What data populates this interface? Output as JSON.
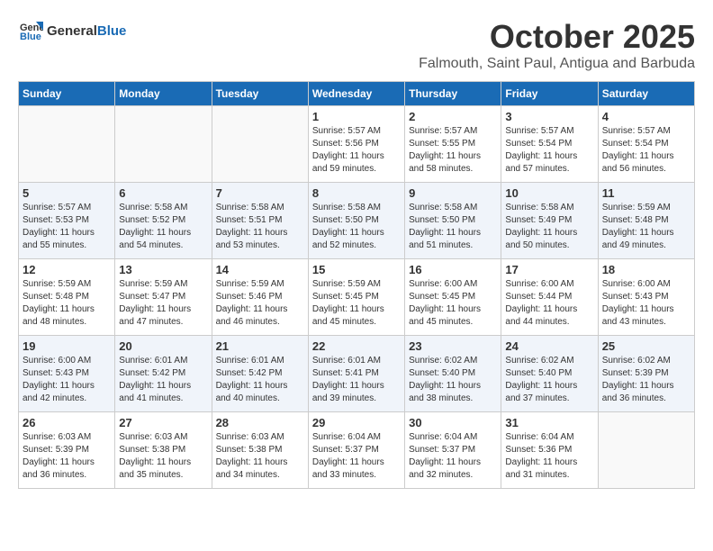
{
  "logo": {
    "text_general": "General",
    "text_blue": "Blue"
  },
  "header": {
    "month": "October 2025",
    "location": "Falmouth, Saint Paul, Antigua and Barbuda"
  },
  "days_of_week": [
    "Sunday",
    "Monday",
    "Tuesday",
    "Wednesday",
    "Thursday",
    "Friday",
    "Saturday"
  ],
  "weeks": [
    [
      {
        "day": "",
        "sunrise": "",
        "sunset": "",
        "daylight": ""
      },
      {
        "day": "",
        "sunrise": "",
        "sunset": "",
        "daylight": ""
      },
      {
        "day": "",
        "sunrise": "",
        "sunset": "",
        "daylight": ""
      },
      {
        "day": "1",
        "sunrise": "Sunrise: 5:57 AM",
        "sunset": "Sunset: 5:56 PM",
        "daylight": "Daylight: 11 hours and 59 minutes."
      },
      {
        "day": "2",
        "sunrise": "Sunrise: 5:57 AM",
        "sunset": "Sunset: 5:55 PM",
        "daylight": "Daylight: 11 hours and 58 minutes."
      },
      {
        "day": "3",
        "sunrise": "Sunrise: 5:57 AM",
        "sunset": "Sunset: 5:54 PM",
        "daylight": "Daylight: 11 hours and 57 minutes."
      },
      {
        "day": "4",
        "sunrise": "Sunrise: 5:57 AM",
        "sunset": "Sunset: 5:54 PM",
        "daylight": "Daylight: 11 hours and 56 minutes."
      }
    ],
    [
      {
        "day": "5",
        "sunrise": "Sunrise: 5:57 AM",
        "sunset": "Sunset: 5:53 PM",
        "daylight": "Daylight: 11 hours and 55 minutes."
      },
      {
        "day": "6",
        "sunrise": "Sunrise: 5:58 AM",
        "sunset": "Sunset: 5:52 PM",
        "daylight": "Daylight: 11 hours and 54 minutes."
      },
      {
        "day": "7",
        "sunrise": "Sunrise: 5:58 AM",
        "sunset": "Sunset: 5:51 PM",
        "daylight": "Daylight: 11 hours and 53 minutes."
      },
      {
        "day": "8",
        "sunrise": "Sunrise: 5:58 AM",
        "sunset": "Sunset: 5:50 PM",
        "daylight": "Daylight: 11 hours and 52 minutes."
      },
      {
        "day": "9",
        "sunrise": "Sunrise: 5:58 AM",
        "sunset": "Sunset: 5:50 PM",
        "daylight": "Daylight: 11 hours and 51 minutes."
      },
      {
        "day": "10",
        "sunrise": "Sunrise: 5:58 AM",
        "sunset": "Sunset: 5:49 PM",
        "daylight": "Daylight: 11 hours and 50 minutes."
      },
      {
        "day": "11",
        "sunrise": "Sunrise: 5:59 AM",
        "sunset": "Sunset: 5:48 PM",
        "daylight": "Daylight: 11 hours and 49 minutes."
      }
    ],
    [
      {
        "day": "12",
        "sunrise": "Sunrise: 5:59 AM",
        "sunset": "Sunset: 5:48 PM",
        "daylight": "Daylight: 11 hours and 48 minutes."
      },
      {
        "day": "13",
        "sunrise": "Sunrise: 5:59 AM",
        "sunset": "Sunset: 5:47 PM",
        "daylight": "Daylight: 11 hours and 47 minutes."
      },
      {
        "day": "14",
        "sunrise": "Sunrise: 5:59 AM",
        "sunset": "Sunset: 5:46 PM",
        "daylight": "Daylight: 11 hours and 46 minutes."
      },
      {
        "day": "15",
        "sunrise": "Sunrise: 5:59 AM",
        "sunset": "Sunset: 5:45 PM",
        "daylight": "Daylight: 11 hours and 45 minutes."
      },
      {
        "day": "16",
        "sunrise": "Sunrise: 6:00 AM",
        "sunset": "Sunset: 5:45 PM",
        "daylight": "Daylight: 11 hours and 45 minutes."
      },
      {
        "day": "17",
        "sunrise": "Sunrise: 6:00 AM",
        "sunset": "Sunset: 5:44 PM",
        "daylight": "Daylight: 11 hours and 44 minutes."
      },
      {
        "day": "18",
        "sunrise": "Sunrise: 6:00 AM",
        "sunset": "Sunset: 5:43 PM",
        "daylight": "Daylight: 11 hours and 43 minutes."
      }
    ],
    [
      {
        "day": "19",
        "sunrise": "Sunrise: 6:00 AM",
        "sunset": "Sunset: 5:43 PM",
        "daylight": "Daylight: 11 hours and 42 minutes."
      },
      {
        "day": "20",
        "sunrise": "Sunrise: 6:01 AM",
        "sunset": "Sunset: 5:42 PM",
        "daylight": "Daylight: 11 hours and 41 minutes."
      },
      {
        "day": "21",
        "sunrise": "Sunrise: 6:01 AM",
        "sunset": "Sunset: 5:42 PM",
        "daylight": "Daylight: 11 hours and 40 minutes."
      },
      {
        "day": "22",
        "sunrise": "Sunrise: 6:01 AM",
        "sunset": "Sunset: 5:41 PM",
        "daylight": "Daylight: 11 hours and 39 minutes."
      },
      {
        "day": "23",
        "sunrise": "Sunrise: 6:02 AM",
        "sunset": "Sunset: 5:40 PM",
        "daylight": "Daylight: 11 hours and 38 minutes."
      },
      {
        "day": "24",
        "sunrise": "Sunrise: 6:02 AM",
        "sunset": "Sunset: 5:40 PM",
        "daylight": "Daylight: 11 hours and 37 minutes."
      },
      {
        "day": "25",
        "sunrise": "Sunrise: 6:02 AM",
        "sunset": "Sunset: 5:39 PM",
        "daylight": "Daylight: 11 hours and 36 minutes."
      }
    ],
    [
      {
        "day": "26",
        "sunrise": "Sunrise: 6:03 AM",
        "sunset": "Sunset: 5:39 PM",
        "daylight": "Daylight: 11 hours and 36 minutes."
      },
      {
        "day": "27",
        "sunrise": "Sunrise: 6:03 AM",
        "sunset": "Sunset: 5:38 PM",
        "daylight": "Daylight: 11 hours and 35 minutes."
      },
      {
        "day": "28",
        "sunrise": "Sunrise: 6:03 AM",
        "sunset": "Sunset: 5:38 PM",
        "daylight": "Daylight: 11 hours and 34 minutes."
      },
      {
        "day": "29",
        "sunrise": "Sunrise: 6:04 AM",
        "sunset": "Sunset: 5:37 PM",
        "daylight": "Daylight: 11 hours and 33 minutes."
      },
      {
        "day": "30",
        "sunrise": "Sunrise: 6:04 AM",
        "sunset": "Sunset: 5:37 PM",
        "daylight": "Daylight: 11 hours and 32 minutes."
      },
      {
        "day": "31",
        "sunrise": "Sunrise: 6:04 AM",
        "sunset": "Sunset: 5:36 PM",
        "daylight": "Daylight: 11 hours and 31 minutes."
      },
      {
        "day": "",
        "sunrise": "",
        "sunset": "",
        "daylight": ""
      }
    ]
  ]
}
